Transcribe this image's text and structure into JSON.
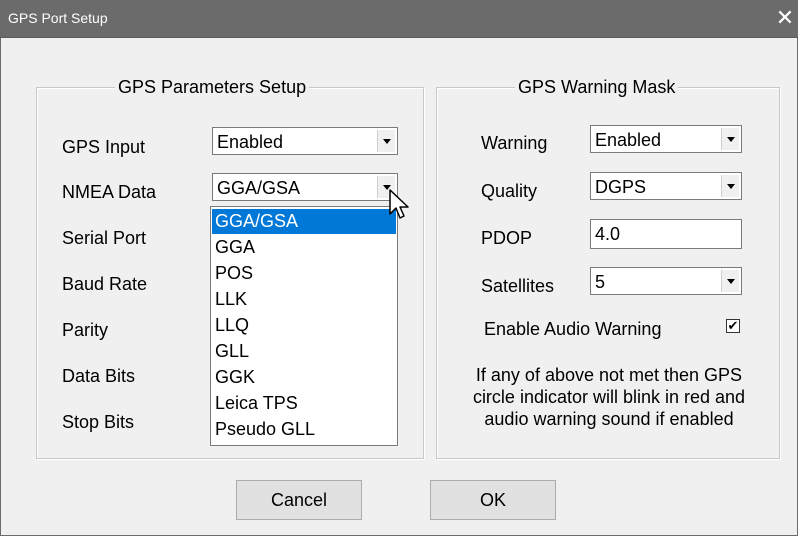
{
  "window": {
    "title": "GPS Port Setup"
  },
  "params": {
    "title": "GPS Parameters Setup",
    "gps_input": {
      "label": "GPS Input",
      "value": "Enabled"
    },
    "nmea_data": {
      "label": "NMEA Data",
      "value": "GGA/GSA"
    },
    "labels": [
      "Serial Port",
      "Baud Rate",
      "Parity",
      "Data Bits",
      "Stop Bits"
    ],
    "nmea_options": [
      "GGA/GSA",
      "GGA",
      "POS",
      "LLK",
      "LLQ",
      "GLL",
      "GGK",
      "Leica TPS",
      "Pseudo GLL"
    ],
    "selected_option": "GGA/GSA"
  },
  "warning": {
    "title": "GPS Warning Mask",
    "warning": {
      "label": "Warning",
      "value": "Enabled"
    },
    "quality": {
      "label": "Quality",
      "value": "DGPS"
    },
    "pdop": {
      "label": "PDOP",
      "value": "4.0"
    },
    "satellites": {
      "label": "Satellites",
      "value": "5"
    },
    "audio": {
      "label": "Enable Audio Warning",
      "checked": true
    },
    "note_lines": [
      "If any of above not met then GPS",
      "circle indicator will blink in red and",
      "audio warning sound if enabled"
    ]
  },
  "buttons": {
    "cancel": "Cancel",
    "ok": "OK"
  },
  "icons": {
    "close": "close-icon",
    "dropdown_arrow": "chevron-down-icon",
    "cursor": "mouse-pointer-icon",
    "check": "checkmark-icon"
  },
  "colors": {
    "selection": "#0078d7",
    "titlebar": "#6b6b6b"
  }
}
